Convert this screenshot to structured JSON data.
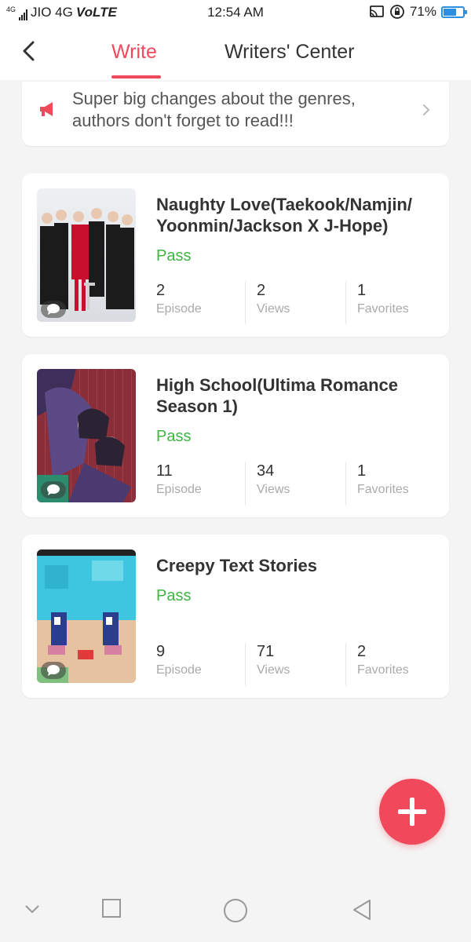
{
  "status_bar": {
    "network": "4G",
    "carrier": "JIO 4G",
    "volte": "VoLTE",
    "time": "12:54 AM",
    "battery_percent": "71%",
    "battery_level": 0.71
  },
  "header": {
    "tabs": [
      {
        "label": "Write",
        "active": true
      },
      {
        "label": "Writers' Center",
        "active": false
      }
    ]
  },
  "notice": {
    "text": "Super big changes about the genres, authors don't forget to read!!!"
  },
  "stories": [
    {
      "title": "Naughty Love(Taekook/Namjin/ Yoonmin/Jackson X J-Hope)",
      "status": "Pass",
      "stats": [
        {
          "value": "2",
          "label": "Episode"
        },
        {
          "value": "2",
          "label": "Views"
        },
        {
          "value": "1",
          "label": "Favorites"
        }
      ]
    },
    {
      "title": "High School(Ultima Romance Season 1)",
      "status": "Pass",
      "stats": [
        {
          "value": "11",
          "label": "Episode"
        },
        {
          "value": "34",
          "label": "Views"
        },
        {
          "value": "1",
          "label": "Favorites"
        }
      ]
    },
    {
      "title": "Creepy Text Stories",
      "status": "Pass",
      "stats": [
        {
          "value": "9",
          "label": "Episode"
        },
        {
          "value": "71",
          "label": "Views"
        },
        {
          "value": "2",
          "label": "Favorites"
        }
      ]
    }
  ],
  "colors": {
    "accent": "#f0495c",
    "pass": "#3cb543",
    "background": "#f4f4f4"
  },
  "icons": {
    "back": "chevron-left-icon",
    "notice": "megaphone-icon",
    "notice_more": "chevron-right-icon",
    "comment": "comment-bubble-icon",
    "fab": "plus-icon",
    "nav": [
      "nav-down-icon",
      "nav-recents-icon",
      "nav-home-icon",
      "nav-back-icon"
    ]
  }
}
